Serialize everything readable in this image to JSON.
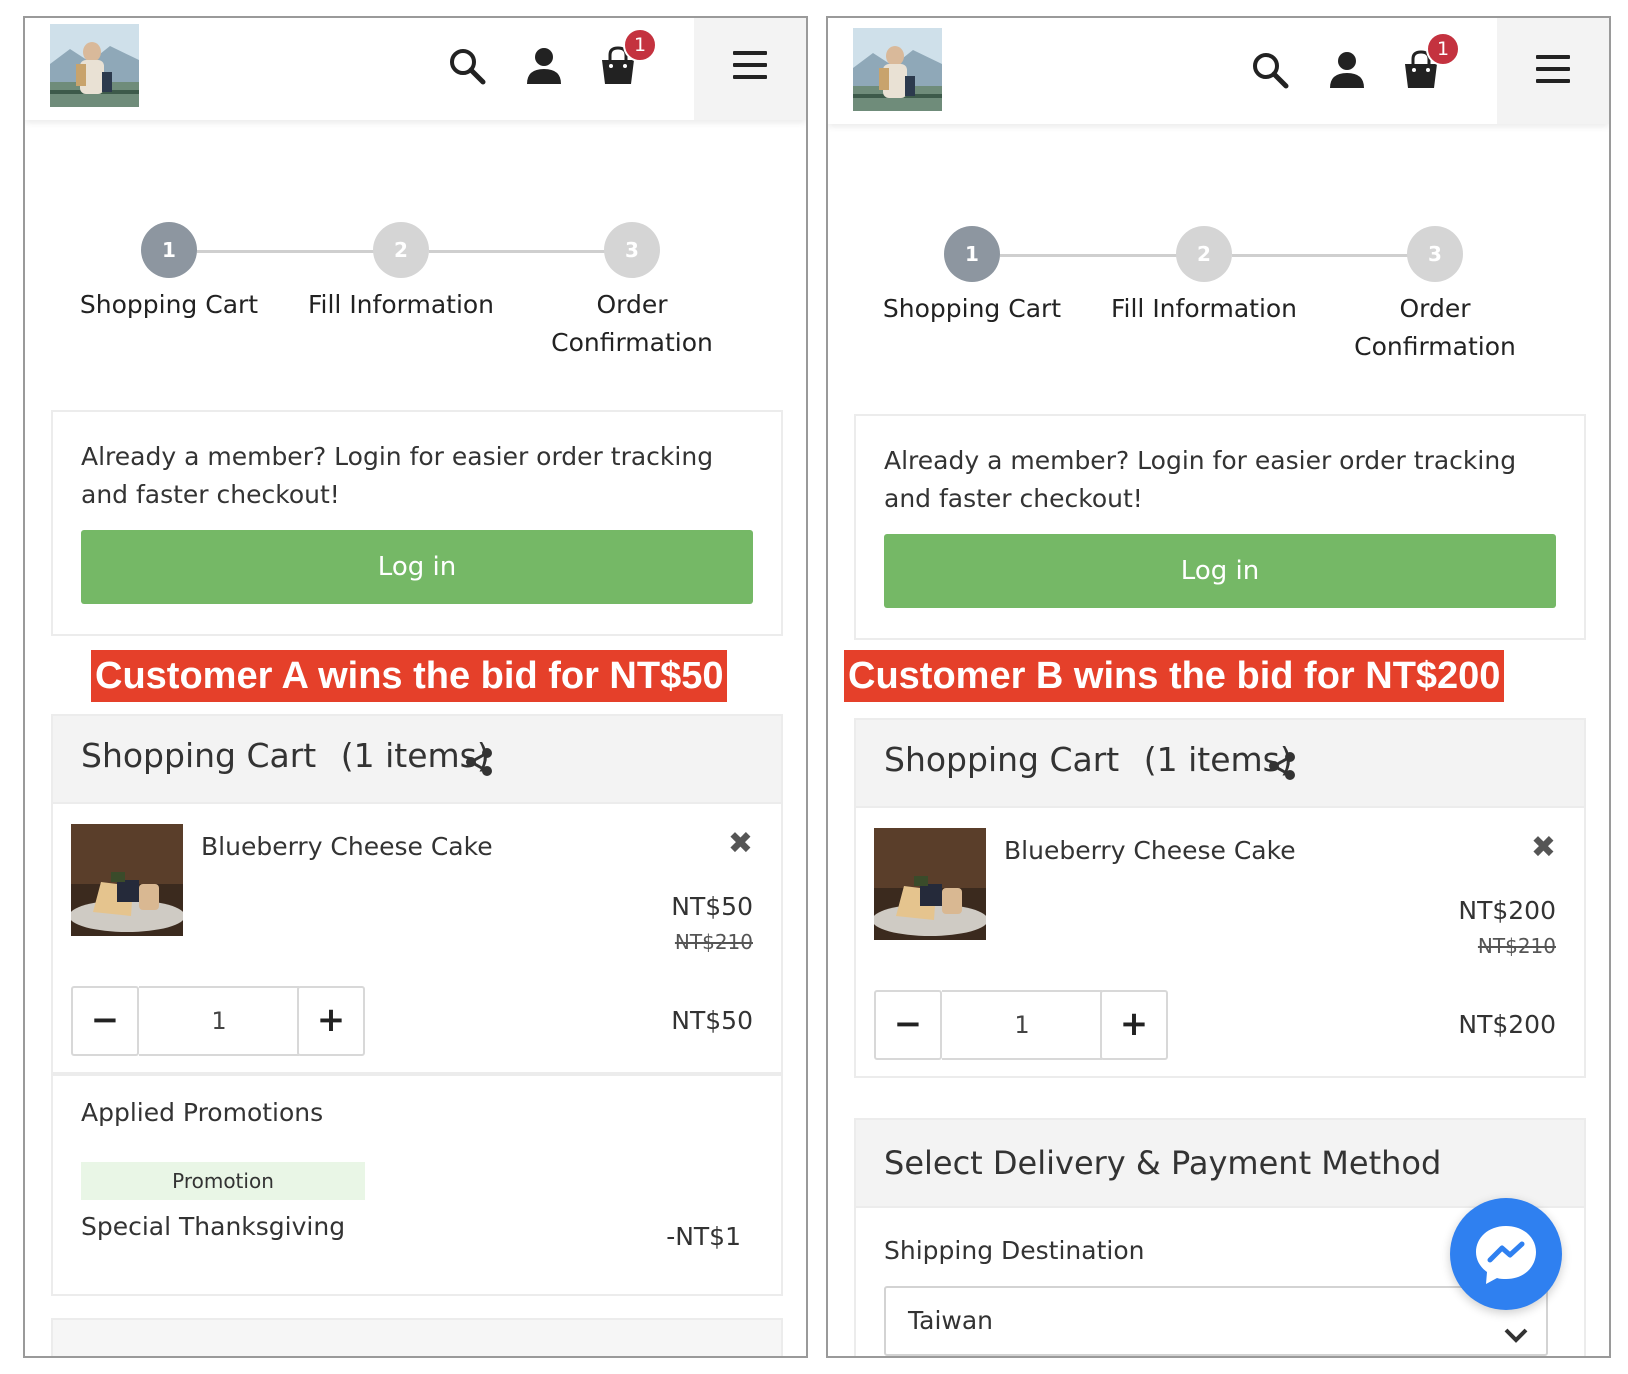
{
  "panels": [
    {
      "header": {
        "cart_count": "1"
      },
      "steps": [
        {
          "num": "1",
          "label": "Shopping Cart"
        },
        {
          "num": "2",
          "label": "Fill Information"
        },
        {
          "num": "3",
          "label": "Order Confirmation"
        }
      ],
      "login": {
        "text": "Already a member? Login for easier order tracking and faster checkout!",
        "button": "Log in"
      },
      "banner": "Customer A wins the bid for NT$50",
      "cart": {
        "title": "Shopping Cart",
        "count_text": "(1 items)",
        "item": {
          "name": "Blueberry Cheese Cake",
          "remove": "✖",
          "price": "NT$50",
          "original_price": "NT$210",
          "qty_minus": "−",
          "qty": "1",
          "qty_plus": "+",
          "line_total": "NT$50"
        }
      },
      "promotions": {
        "title": "Applied Promotions",
        "tag": "Promotion",
        "name": "Special Thanksgiving",
        "amount": "-NT$1"
      }
    },
    {
      "header": {
        "cart_count": "1"
      },
      "steps": [
        {
          "num": "1",
          "label": "Shopping Cart"
        },
        {
          "num": "2",
          "label": "Fill Information"
        },
        {
          "num": "3",
          "label": "Order Confirmation"
        }
      ],
      "login": {
        "text": "Already a member? Login for easier order tracking and faster checkout!",
        "button": "Log in"
      },
      "banner": "Customer B wins the bid for NT$200",
      "cart": {
        "title": "Shopping Cart",
        "count_text": "(1 items)",
        "item": {
          "name": "Blueberry Cheese Cake",
          "remove": "✖",
          "price": "NT$200",
          "original_price": "NT$210",
          "qty_minus": "−",
          "qty": "1",
          "qty_plus": "+",
          "line_total": "NT$200"
        }
      },
      "delivery": {
        "title": "Select Delivery & Payment Method",
        "shipping_label": "Shipping Destination",
        "shipping_value": "Taiwan"
      }
    }
  ],
  "colors": {
    "login_green": "#75b866",
    "banner_red": "#e5402a",
    "badge_red": "#c4323f",
    "messenger_blue": "#2f80f0",
    "step_active": "#8d96a0",
    "step_inactive": "#d5d5d5"
  },
  "icons": [
    "search-icon",
    "user-icon",
    "cart-bag-icon",
    "menu-icon",
    "share-icon",
    "close-icon",
    "chevron-down-icon",
    "messenger-icon"
  ]
}
